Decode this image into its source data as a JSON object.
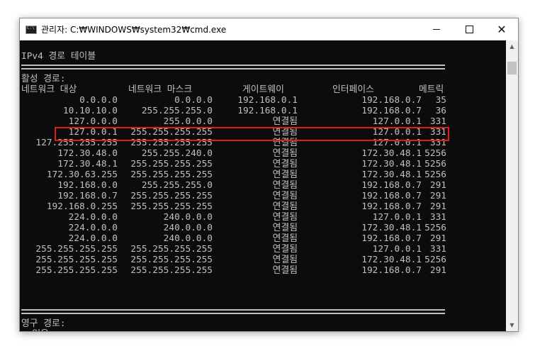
{
  "window": {
    "title": "관리자: C:₩WINDOWS₩system32₩cmd.exe",
    "icons": {
      "app": "cmd-icon",
      "minimize": "minimize-icon",
      "maximize": "maximize-icon",
      "close": "close-icon"
    },
    "close_glyph": "✕"
  },
  "console": {
    "heading": "IPv4 경로 테이블",
    "active_label": "활성 경로:",
    "headers": {
      "dest": "네트워크 대상",
      "mask": "네트워크 마스크",
      "gateway": "게이트웨이",
      "iface": "인터페이스",
      "metric": "메트릭"
    },
    "routes": [
      {
        "dest": "0.0.0.0",
        "mask": "0.0.0.0",
        "gateway": "192.168.0.1",
        "iface": "192.168.0.7",
        "metric": "35"
      },
      {
        "dest": "10.10.10.0",
        "mask": "255.255.255.0",
        "gateway": "192.168.0.1",
        "iface": "192.168.0.7",
        "metric": "36"
      },
      {
        "dest": "127.0.0.0",
        "mask": "255.0.0.0",
        "gateway": "연결됨",
        "iface": "127.0.0.1",
        "metric": "331"
      },
      {
        "dest": "127.0.0.1",
        "mask": "255.255.255.255",
        "gateway": "연결됨",
        "iface": "127.0.0.1",
        "metric": "331"
      },
      {
        "dest": "127.255.255.255",
        "mask": "255.255.255.255",
        "gateway": "연결됨",
        "iface": "127.0.0.1",
        "metric": "331"
      },
      {
        "dest": "172.30.48.0",
        "mask": "255.255.240.0",
        "gateway": "연결됨",
        "iface": "172.30.48.1",
        "metric": "5256"
      },
      {
        "dest": "172.30.48.1",
        "mask": "255.255.255.255",
        "gateway": "연결됨",
        "iface": "172.30.48.1",
        "metric": "5256"
      },
      {
        "dest": "172.30.63.255",
        "mask": "255.255.255.255",
        "gateway": "연결됨",
        "iface": "172.30.48.1",
        "metric": "5256"
      },
      {
        "dest": "192.168.0.0",
        "mask": "255.255.255.0",
        "gateway": "연결됨",
        "iface": "192.168.0.7",
        "metric": "291"
      },
      {
        "dest": "192.168.0.7",
        "mask": "255.255.255.255",
        "gateway": "연결됨",
        "iface": "192.168.0.7",
        "metric": "291"
      },
      {
        "dest": "192.168.0.255",
        "mask": "255.255.255.255",
        "gateway": "연결됨",
        "iface": "192.168.0.7",
        "metric": "291"
      },
      {
        "dest": "224.0.0.0",
        "mask": "240.0.0.0",
        "gateway": "연결됨",
        "iface": "127.0.0.1",
        "metric": "331"
      },
      {
        "dest": "224.0.0.0",
        "mask": "240.0.0.0",
        "gateway": "연결됨",
        "iface": "172.30.48.1",
        "metric": "5256"
      },
      {
        "dest": "224.0.0.0",
        "mask": "240.0.0.0",
        "gateway": "연결됨",
        "iface": "192.168.0.7",
        "metric": "291"
      },
      {
        "dest": "255.255.255.255",
        "mask": "255.255.255.255",
        "gateway": "연결됨",
        "iface": "127.0.0.1",
        "metric": "331"
      },
      {
        "dest": "255.255.255.255",
        "mask": "255.255.255.255",
        "gateway": "연결됨",
        "iface": "172.30.48.1",
        "metric": "5256"
      },
      {
        "dest": "255.255.255.255",
        "mask": "255.255.255.255",
        "gateway": "연결됨",
        "iface": "192.168.0.7",
        "metric": "291"
      }
    ],
    "persistent_label": "영구 경로:",
    "persistent_value": "  없음",
    "highlighted_route_index": 1
  },
  "colors": {
    "console_bg": "#0c0c0c",
    "console_text": "#c0c0c0",
    "highlight_border": "#e11a1a"
  }
}
